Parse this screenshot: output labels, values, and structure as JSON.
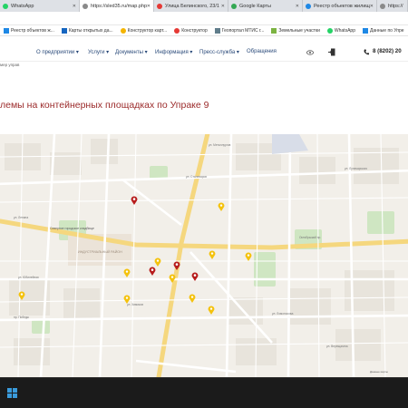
{
  "browser": {
    "tabs": [
      {
        "label": "WhatsApp",
        "color": "#25d366"
      },
      {
        "label": "https://sled35.ru/map.php",
        "color": "#8a8a8a",
        "active": true
      },
      {
        "label": "Улица Белинского, 23/1",
        "color": "#e53935"
      },
      {
        "label": "Google Карты",
        "color": "#34a853"
      },
      {
        "label": "Реестр объектов жилищ",
        "color": "#1e88e5"
      },
      {
        "label": "https://",
        "color": "#8a8a8a"
      }
    ],
    "bookmarks": [
      "Реестр объектов ж...",
      "Карты открытых да...",
      "Конструктор карт...",
      "Конструктор",
      "Геопортал МТИС г...",
      "Земельные участки",
      "WhatsApp",
      "Данные по Упре"
    ]
  },
  "site": {
    "nav": [
      "О предприятии ▾",
      "Услуги ▾",
      "Документы ▾",
      "Информация ▾",
      "Пресс-служба ▾",
      "Обращения"
    ],
    "phone": "8 (8202) 20",
    "breadcrumb": "мер управ"
  },
  "page": {
    "title": "лемы на контейнерных площадках по Упраке 9"
  },
  "map": {
    "labels": {
      "district": "ИНДУСТРИАЛЬНЫЙ РАЙОН",
      "cemetery": "Северное городское кладбище",
      "corner": "Данные карты"
    },
    "streets": [
      "ул. Ленина",
      "ул. Металлургов",
      "Октябрьский пр.",
      "ул. Сталеваров",
      "ул. Юбилейная",
      "ул. Ломоносова",
      "ул. Химиков",
      "ул. Луначарского",
      "пр. Победы",
      "ул. Верещагина"
    ],
    "pins_red": 4,
    "pins_yellow": 10
  }
}
